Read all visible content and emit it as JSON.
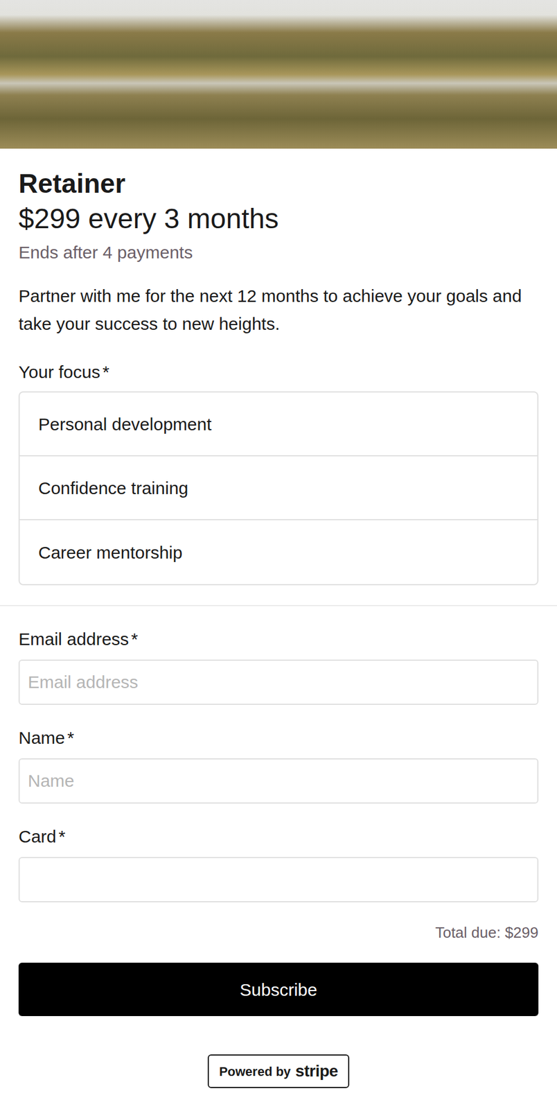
{
  "header_image": {
    "kind": "photo"
  },
  "product": {
    "title": "Retainer",
    "price": "$299 every 3 months",
    "ends": "Ends after 4 payments",
    "description": "Partner with me for the next 12 months to achieve your goals and take your success to new heights."
  },
  "focus": {
    "label": "Your focus",
    "mark": "*",
    "options": [
      {
        "label": "Personal development",
        "selected": false
      },
      {
        "label": "Confidence training",
        "selected": false
      },
      {
        "label": "Career mentorship",
        "selected": false
      }
    ]
  },
  "fields": [
    {
      "label": "Email address",
      "mark": "*",
      "placeholder": "Email address"
    },
    {
      "label": "Name",
      "mark": "*",
      "placeholder": "Name"
    },
    {
      "label": "Card",
      "mark": "*",
      "placeholder": ""
    }
  ],
  "total": "Total due: $299",
  "button": "Subscribe",
  "footer": {
    "powered": "Powered by",
    "logo": "stripe"
  }
}
